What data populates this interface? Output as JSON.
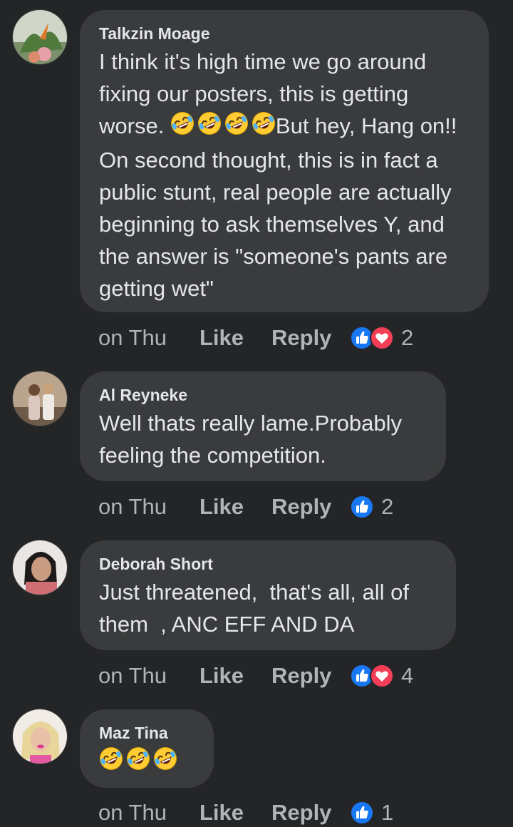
{
  "colors": {
    "background": "#242527",
    "bubble": "#3a3b3c",
    "text": "#e4e6eb",
    "secondary": "#b0b3b8",
    "like_blue": "#1877f2",
    "love_red": "#f33e58"
  },
  "comments": [
    {
      "author": "Talkzin Moage",
      "text_before": "I think it's high time we go around fixing our posters, this is getting worse. ",
      "emojis": [
        "rolling-on-floor-laughing",
        "rolling-on-floor-laughing",
        "rolling-on-floor-laughing",
        "rolling-on-floor-laughing"
      ],
      "text_after": "But hey, Hang on!! On second thought, this is in fact a public stunt, real people are actually beginning to ask themselves Y, and the answer is \"someone's pants are getting wet\"",
      "time": "on Thu",
      "like_label": "Like",
      "reply_label": "Reply",
      "reaction_types": [
        "like",
        "love"
      ],
      "reaction_count": "2"
    },
    {
      "author": "Al Reyneke",
      "text": "Well thats really lame.Probably feeling the competition.",
      "time": "on Thu",
      "like_label": "Like",
      "reply_label": "Reply",
      "reaction_types": [
        "like"
      ],
      "reaction_count": "2"
    },
    {
      "author": "Deborah Short",
      "text": "Just threatened,  that's all, all of them  , ANC EFF AND DA",
      "time": "on Thu",
      "like_label": "Like",
      "reply_label": "Reply",
      "reaction_types": [
        "like",
        "love"
      ],
      "reaction_count": "4"
    },
    {
      "author": "Maz Tina",
      "emojis": [
        "rolling-on-floor-laughing",
        "rolling-on-floor-laughing",
        "rolling-on-floor-laughing"
      ],
      "time": "on Thu",
      "like_label": "Like",
      "reply_label": "Reply",
      "reaction_types": [
        "like"
      ],
      "reaction_count": "1"
    }
  ]
}
